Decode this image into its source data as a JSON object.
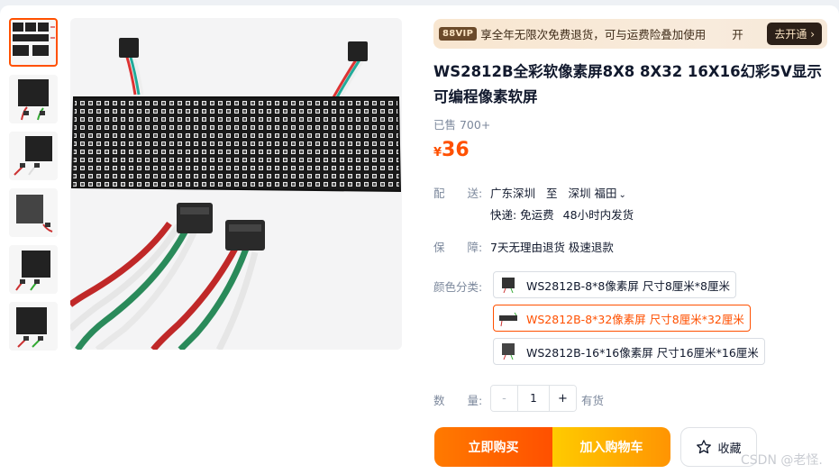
{
  "vip": {
    "badge": "88VIP",
    "text": "享全年无限次免费退货，可与运费险叠加使用",
    "tail": "开",
    "button": "去开通 ›"
  },
  "product": {
    "title": "WS2812B全彩软像素屏8X8 8X32 16X16幻彩5V显示可编程像素软屏",
    "sold": "已售 700+",
    "price_currency": "¥",
    "price_value": "36"
  },
  "shipping": {
    "label": "配　　送:",
    "from": "广东深圳",
    "to_word": "至",
    "dest": "深圳 福田",
    "express": "快递: 免运费",
    "dispatch": "48小时内发货"
  },
  "guarantee": {
    "label": "保　　障:",
    "text": "7天无理由退货 极速退款"
  },
  "color": {
    "label": "颜色分类:",
    "options": [
      {
        "text": "WS2812B-8*8像素屏 尺寸8厘米*8厘米",
        "selected": false
      },
      {
        "text": "WS2812B-8*32像素屏 尺寸8厘米*32厘米",
        "selected": true
      },
      {
        "text": "WS2812B-16*16像素屏 尺寸16厘米*16厘米",
        "selected": false
      }
    ]
  },
  "quantity": {
    "label": "数　　量:",
    "minus": "-",
    "value": "1",
    "plus": "+",
    "stock": "有货"
  },
  "actions": {
    "buy_now": "立即购买",
    "add_cart": "加入购物车",
    "favorite": "收藏"
  },
  "watermark": "CSDN @老怪.",
  "colors": {
    "accent": "#ff5000",
    "buy_gradient_start": "#ff7a00",
    "cart_gradient_start": "#ffcb00",
    "cart_gradient_end": "#ff9402"
  },
  "thumbnails": [
    {
      "icon": "led-matrix-thumbnail"
    },
    {
      "icon": "led-matrix-thumbnail"
    },
    {
      "icon": "led-matrix-thumbnail"
    },
    {
      "icon": "led-matrix-thumbnail"
    },
    {
      "icon": "led-matrix-thumbnail"
    },
    {
      "icon": "led-matrix-thumbnail"
    }
  ]
}
